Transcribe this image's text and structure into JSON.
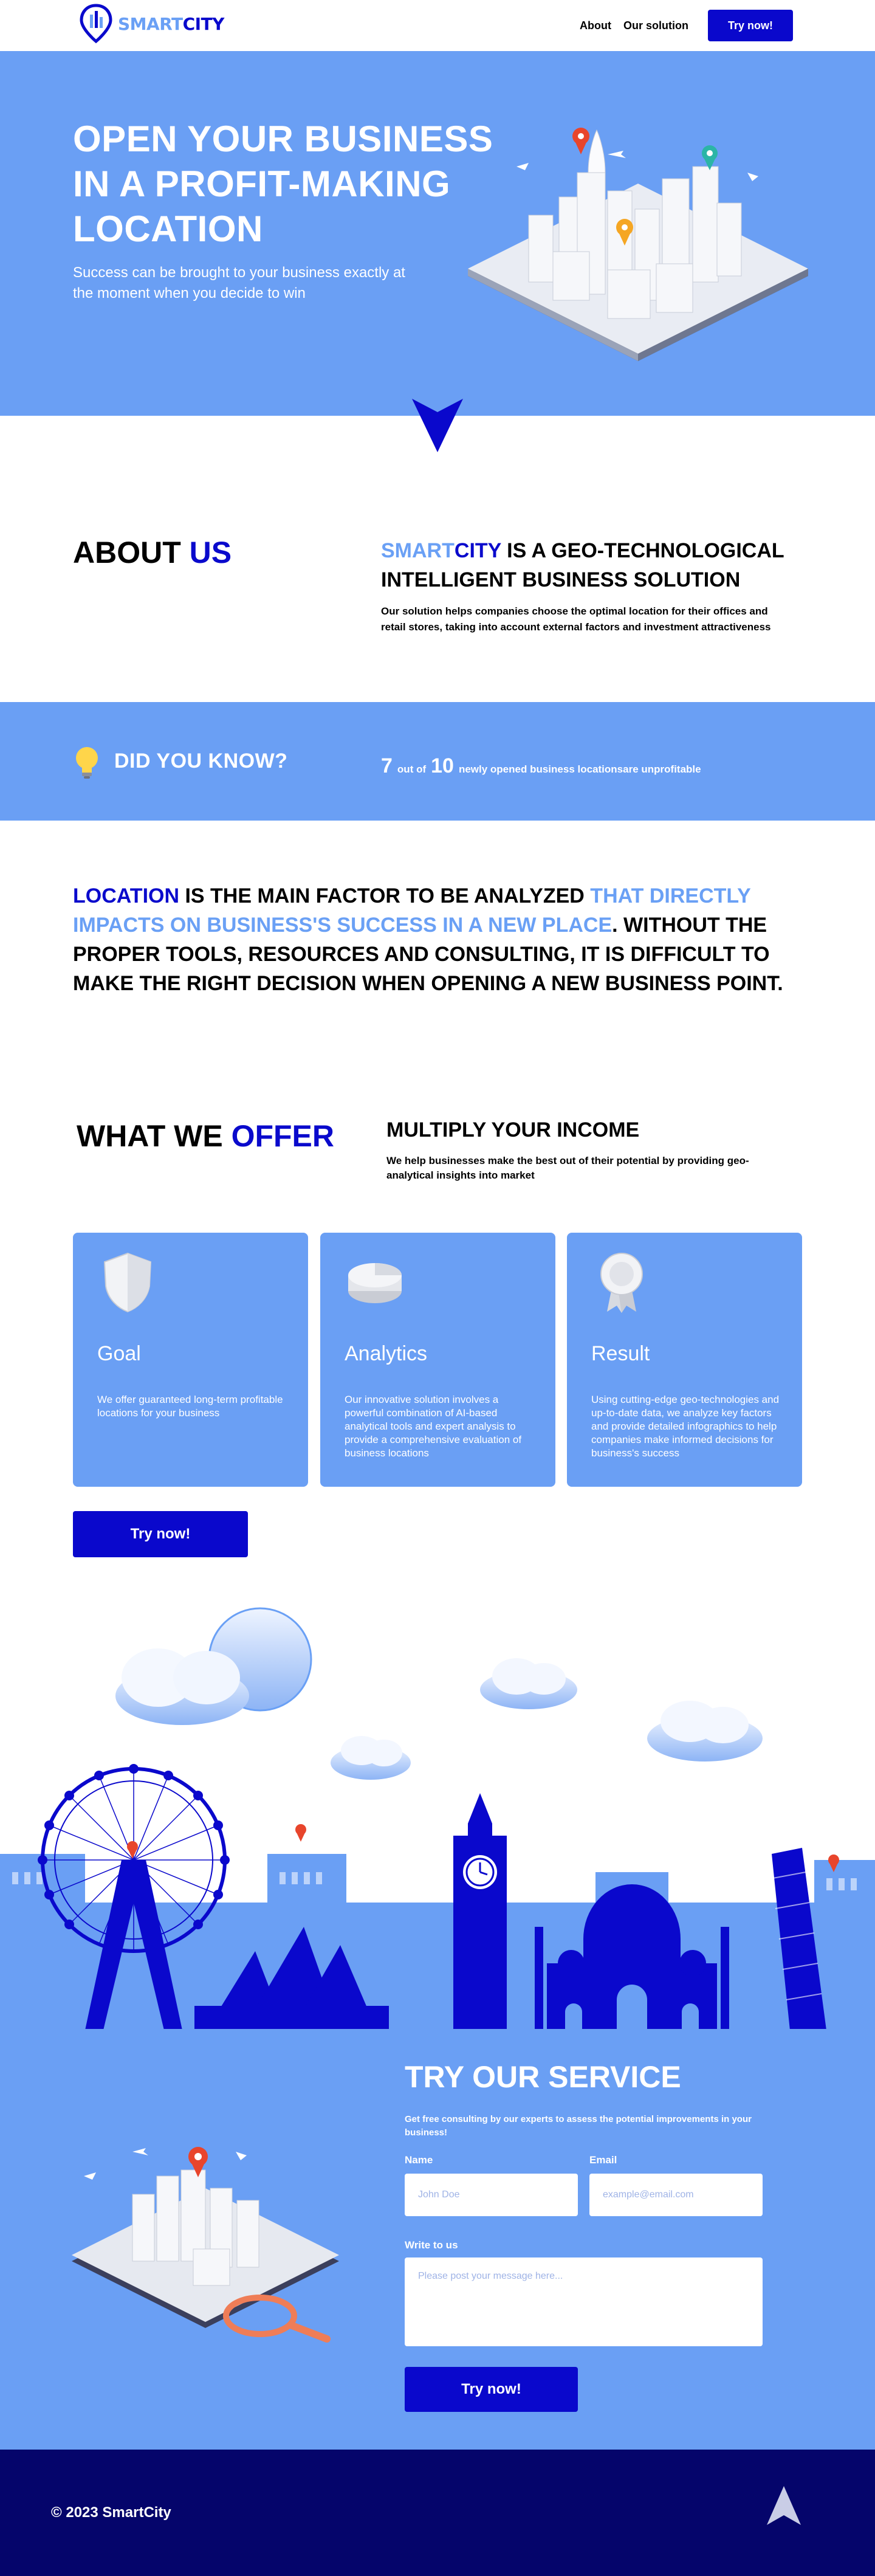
{
  "header": {
    "logo": {
      "smart": "SMART",
      "city": "CITY"
    },
    "nav": [
      "About",
      "Our solution"
    ],
    "cta": "Try now!"
  },
  "hero": {
    "title": "OPEN YOUR BUSINESS IN A PROFIT-MAKING LOCATION",
    "subtitle": "Success can be brought to your business exactly at the moment when you decide to win"
  },
  "about": {
    "title_a": "ABOUT ",
    "title_b": "US",
    "head_smart": "SMART",
    "head_city": "CITY",
    "head_rest": " IS A GEO-TECHNOLOGICAL INTELLIGENT BUSINESS SOLUTION",
    "text": "Our solution helps companies choose the optimal location for their offices and retail stores, taking into account external factors and investment attractiveness"
  },
  "did_you_know": {
    "title": "DID YOU KNOW?",
    "num1": "7",
    "out_of": "out of",
    "num2": "10",
    "text": "newly opened business locationsare unprofitable"
  },
  "location": {
    "p1": "LOCATION",
    "p2": " IS THE MAIN FACTOR TO BE ANALYZED ",
    "p3": "THAT DIRECTLY IMPACTS ON BUSINESS'S SUCCESS IN A NEW PLACE",
    "p4": ". WITHOUT THE PROPER TOOLS, RESOURCES AND CONSULTING, IT IS DIFFICULT TO MAKE THE RIGHT DECISION WHEN OPENING A NEW BUSINESS POINT."
  },
  "offer": {
    "title_a": "WHAT WE ",
    "title_b": "OFFER",
    "head": "MULTIPLY YOUR INCOME",
    "text": "We help businesses make the best out of their potential by providing geo-analytical insights into market",
    "cards": [
      {
        "title": "Goal",
        "text": "We offer guaranteed long-term profitable locations for your business",
        "icon": "shield-icon"
      },
      {
        "title": "Analytics",
        "text": "Our innovative solution involves a powerful combination of AI-based analytical tools and expert analysis to provide a comprehensive evaluation of business locations",
        "icon": "pie-chart-icon"
      },
      {
        "title": "Result",
        "text": "Using cutting-edge geo-technologies and up-to-date data, we analyze key factors and provide detailed infographics to help companies make informed decisions for business's success",
        "icon": "award-badge-icon"
      }
    ],
    "cta": "Try now!"
  },
  "form": {
    "title": "TRY OUR SERVICE",
    "subtitle": "Get free consulting by our experts to assess the potential improvements in your business!",
    "name_label": "Name",
    "name_placeholder": "John Doe",
    "email_label": "Email",
    "email_placeholder": "example@email.com",
    "message_label": "Write to us",
    "message_placeholder": "Please post your message here...",
    "submit": "Try now!"
  },
  "footer": {
    "copyright": "© 2023 SmartCity"
  },
  "colors": {
    "primary_blue": "#6a9ff4",
    "dark_blue": "#0a08cc",
    "navy": "#05056b"
  }
}
